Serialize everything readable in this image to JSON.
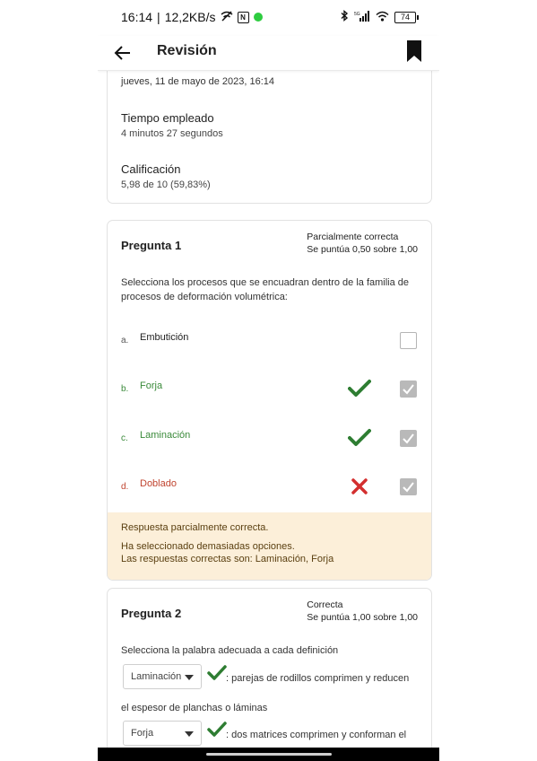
{
  "status_bar": {
    "time": "16:14",
    "speed": "12,2KB/s",
    "battery": "74",
    "icons": [
      "wifi-off-icon",
      "n-icon",
      "green-dot-icon",
      "bluetooth-icon",
      "signal-icon",
      "wifi-icon",
      "battery-icon"
    ]
  },
  "app_bar": {
    "title": "Revisión",
    "back_icon": "arrow-left-icon",
    "bookmark_icon": "bookmark-icon"
  },
  "summary": {
    "date": "jueves, 11 de mayo de 2023, 16:14",
    "time_label": "Tiempo empleado",
    "time_value": "4 minutos 27 segundos",
    "grade_label": "Calificación",
    "grade_value": "5,98 de 10 (59,83%)"
  },
  "question1": {
    "title": "Pregunta 1",
    "status": "Parcialmente correcta",
    "score": "Se puntúa 0,50 sobre 1,00",
    "text": "Selecciona los procesos que se encuadran dentro de la familia de procesos de deformación volumétrica:",
    "options": [
      {
        "letter": "a.",
        "label": "Embutición",
        "state": "none",
        "checked": false
      },
      {
        "letter": "b.",
        "label": "Forja",
        "state": "correct",
        "checked": true
      },
      {
        "letter": "c.",
        "label": "Laminación",
        "state": "correct",
        "checked": true
      },
      {
        "letter": "d.",
        "label": "Doblado",
        "state": "incorrect",
        "checked": true
      }
    ],
    "feedback": {
      "summary": "Respuesta parcialmente correcta.",
      "line1": "Ha seleccionado demasiadas opciones.",
      "line2": "Las respuestas correctas son: Laminación, Forja"
    }
  },
  "question2": {
    "title": "Pregunta 2",
    "status": "Correcta",
    "score": "Se puntúa 1,00 sobre 1,00",
    "text": "Selecciona la palabra adecuada a cada definición",
    "items": [
      {
        "selected": "Laminación",
        "definition": ": parejas de rodillos comprimen y reducen",
        "continuation": "el espesor de planchas o láminas"
      },
      {
        "selected": "Forja",
        "definition": ": dos matrices comprimen y conforman el"
      }
    ]
  },
  "colors": {
    "correct": "#2e7d32",
    "incorrect": "#d32f2f",
    "feedback_bg": "#fcefd9"
  }
}
